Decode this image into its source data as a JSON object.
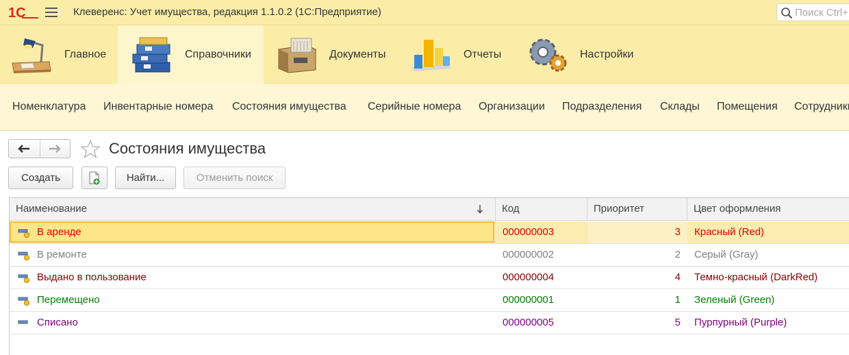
{
  "titlebar": {
    "logo_text": "1С",
    "title": "Клеверенс: Учет имущества, редакция 1.1.0.2  (1С:Предприятие)",
    "search_placeholder": "Поиск Ctrl+F"
  },
  "sections": [
    {
      "label": "Главное",
      "icon": "desk-lamp-icon",
      "active": false
    },
    {
      "label": "Справочники",
      "icon": "folders-icon",
      "active": true
    },
    {
      "label": "Документы",
      "icon": "file-cabinet-icon",
      "active": false
    },
    {
      "label": "Отчеты",
      "icon": "bar-chart-icon",
      "active": false
    },
    {
      "label": "Настройки",
      "icon": "gears-icon",
      "active": false
    }
  ],
  "subsections": [
    "Номенклатура",
    "Инвентарные номера",
    "Состояния имущества",
    "Серийные номера",
    "Организации",
    "Подразделения",
    "Склады",
    "Помещения",
    "Сотрудники"
  ],
  "form": {
    "title": "Состояния имущества",
    "buttons": {
      "create": "Создать",
      "find": "Найти...",
      "cancel_search": "Отменить поиск"
    }
  },
  "table": {
    "columns": [
      "Наименование",
      "Код",
      "Приоритет",
      "Цвет оформления"
    ],
    "rows": [
      {
        "name": "В аренде",
        "code": "000000003",
        "priority": "3",
        "color_name": "Красный (Red)",
        "text_color": "#e00000",
        "selected": true
      },
      {
        "name": "В ремонте",
        "code": "000000002",
        "priority": "2",
        "color_name": "Серый (Gray)",
        "text_color": "#808080",
        "selected": false
      },
      {
        "name": "Выдано в пользование",
        "code": "000000004",
        "priority": "4",
        "color_name": "Темно-красный (DarkRed)",
        "text_color": "#8b0000",
        "selected": false
      },
      {
        "name": "Перемещено",
        "code": "000000001",
        "priority": "1",
        "color_name": "Зеленый (Green)",
        "text_color": "#008000",
        "selected": false
      },
      {
        "name": "Списано",
        "code": "000000005",
        "priority": "5",
        "color_name": "Пурпурный (Purple)",
        "text_color": "#800080",
        "selected": false
      }
    ]
  },
  "colors": {
    "titlebar_bg": "#fbeda8",
    "section_active_bg": "#fdf6cc",
    "subbar_bg": "#fdf7d6",
    "selected_row_bg": "#fcecb0",
    "focus_frame": "#f2c037"
  }
}
